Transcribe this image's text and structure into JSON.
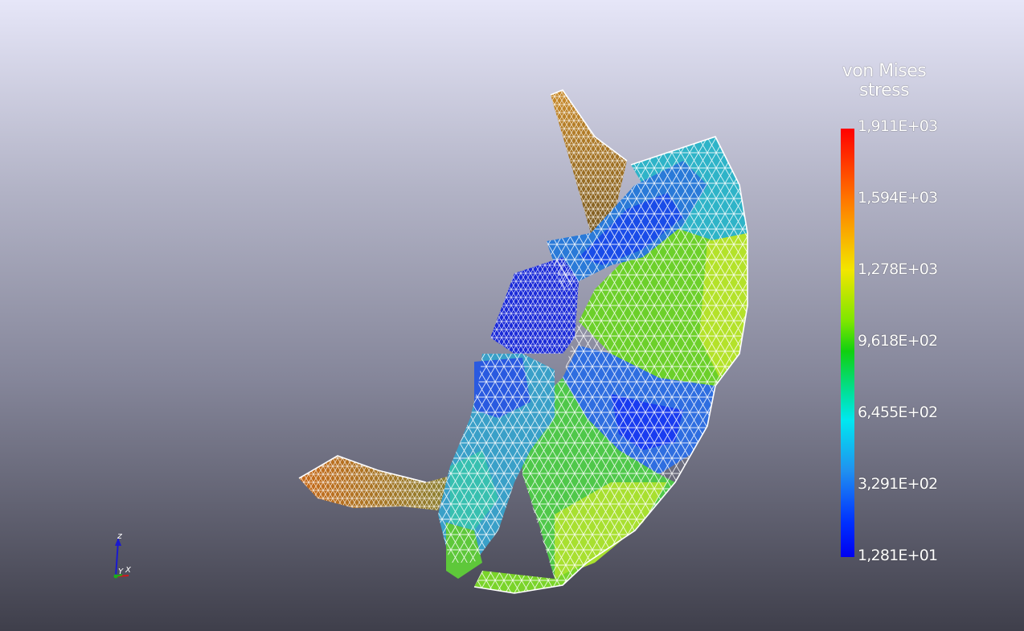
{
  "colorbar": {
    "title_line1": "von Mises",
    "title_line2": "stress",
    "ticks": [
      "1,911E+03",
      "1,594E+03",
      "1,278E+03",
      "9,618E+02",
      "6,455E+02",
      "3,291E+02",
      "1,281E+01"
    ],
    "min": 12.81,
    "max": 1911
  },
  "axes": {
    "z": "z",
    "y": "Y",
    "x": "X"
  },
  "colors": {
    "high": "#ff0000",
    "mid": "#10d010",
    "low": "#0000f0",
    "mesh_lines": "#ffffff"
  }
}
